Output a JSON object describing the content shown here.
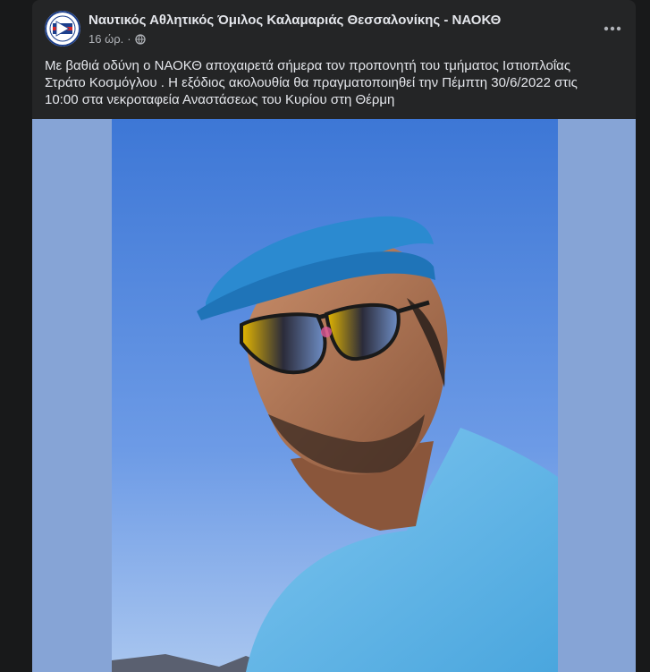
{
  "post": {
    "page_name": "Ναυτικός Αθλητικός Όμιλος Καλαμαριάς Θεσσαλονίκης - ΝΑΟΚΘ",
    "time": "16 ώρ.",
    "separator": "·",
    "privacy_icon": "globe-icon",
    "more_icon": "more-options-icon",
    "text_lines": [
      "Με βαθιά οδύνη ο ΝΑΟΚΘ αποχαιρετά σήμερα τον προπονητή του τμήματος Ιστιοπλοΐας",
      "Στράτο Κοσμόγλου . Η εξόδιος ακολουθία θα πραγματοποιηθεί την Πέμπτη 30/6/2022 στις",
      "10:00 στα νεκροταφεία Αναστάσεως του Κυρίου στη Θέρμη"
    ]
  },
  "colors": {
    "page_bg": "#18191a",
    "card_bg": "#242526",
    "primary_text": "#e4e6eb",
    "secondary_text": "#b0b3b8",
    "photo_bg": "#86a4d6"
  }
}
